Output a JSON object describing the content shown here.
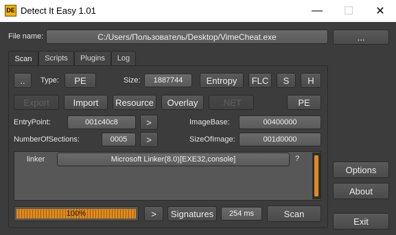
{
  "window": {
    "title": "Detect It Easy 1.01",
    "icon_text": "DE",
    "minimize_glyph": "—",
    "maximize_glyph": "☐",
    "close_glyph": "✕"
  },
  "file": {
    "label": "File name:",
    "path": "C:/Users/Пользователь/Desktop/VimeCheat.exe",
    "browse_label": "..."
  },
  "tabs": [
    "Scan",
    "Scripts",
    "Plugins",
    "Log"
  ],
  "row1": {
    "dots_label": "..",
    "type_label": "Type:",
    "type_value": "PE",
    "size_label": "Size:",
    "size_value": "1887744",
    "entropy_label": "Entropy",
    "flc_label": "FLC",
    "s_label": "S",
    "h_label": "H"
  },
  "row2": {
    "export_label": "Export",
    "import_label": "Import",
    "resource_label": "Resource",
    "overlay_label": "Overlay",
    "net_label": ".NET",
    "pe_label": "PE"
  },
  "row3": {
    "entrypoint_label": "EntryPoint:",
    "entrypoint_value": "001c40c8",
    "arrow": ">",
    "imagebase_label": "ImageBase:",
    "imagebase_value": "00400000"
  },
  "row4": {
    "sections_label": "NumberOfSections:",
    "sections_value": "0005",
    "arrow": ">",
    "sizeofimage_label": "SizeOfImage:",
    "sizeofimage_value": "001d0000"
  },
  "results": [
    {
      "type": "linker",
      "value": "Microsoft Linker(8.0)[EXE32,console]",
      "info": "?"
    }
  ],
  "bottom": {
    "progress_percent": 100,
    "progress_text": "100%",
    "arrow": ">",
    "signatures_label": "Signatures",
    "time_value": "254 ms",
    "scan_label": "Scan"
  },
  "side": {
    "options_label": "Options",
    "about_label": "About",
    "exit_label": "Exit"
  },
  "colors": {
    "background": "#3c3c3c",
    "accent": "#e08a1e"
  }
}
